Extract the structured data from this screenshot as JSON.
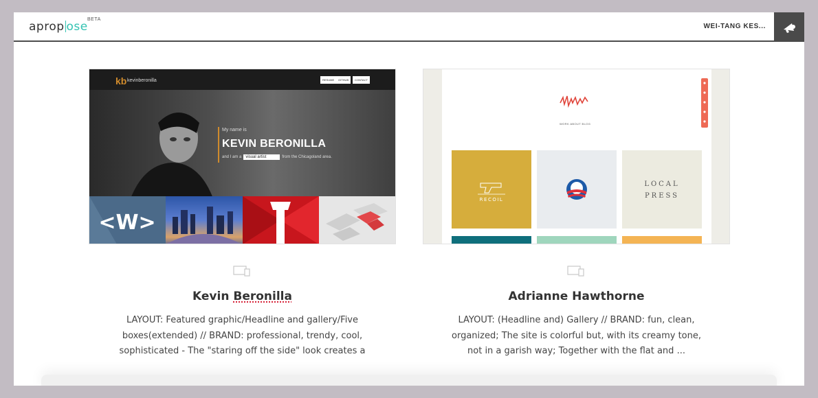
{
  "header": {
    "logo_part1": "aprop",
    "logo_part2": "ose",
    "beta": "BETA",
    "user_name": "WEI-TANG KES...",
    "notifications_icon": "megaphone-icon"
  },
  "cards": [
    {
      "title_first": "Kevin ",
      "title_last": "Beronilla",
      "description": "LAYOUT: Featured graphic/Headline and gallery/Five boxes(extended) // BRAND: professional, trendy, cool, sophisticated - The \"staring off the side\" look creates a",
      "device_icon": "devices-icon",
      "thumb": {
        "logo": "kb",
        "site_name": "kevinberonilla",
        "nav": [
          "RESUME",
          "GITHUB",
          "CONTACT"
        ],
        "intro": "My name is",
        "headline": "KEVIN BERONILLA",
        "line_prefix": "and I am a",
        "select_value": "visual artist",
        "line_suffix": "from the Chicagoland area."
      }
    },
    {
      "title": "Adrianne Hawthorne",
      "description": "LAYOUT: (Headline and) Gallery // BRAND: fun, clean, organized; The site is colorful but, with its creamy tone, not in a garish way; Together with the flat and",
      "ellipsis": "...",
      "device_icon": "devices-icon",
      "thumb": {
        "nav": "WORK    ABOUT    BLOG",
        "tile1": "RECOIL",
        "tile3_line1": "LOCAL",
        "tile3_line2": "PRESS",
        "colors": {
          "mustard": "#d6ad3c",
          "pale": "#e9ecef",
          "cream": "#ecebe0",
          "teal": "#0f6f7c",
          "mint": "#9fd6bd",
          "orange": "#f4b454",
          "coral": "#ee6a55"
        }
      }
    }
  ]
}
